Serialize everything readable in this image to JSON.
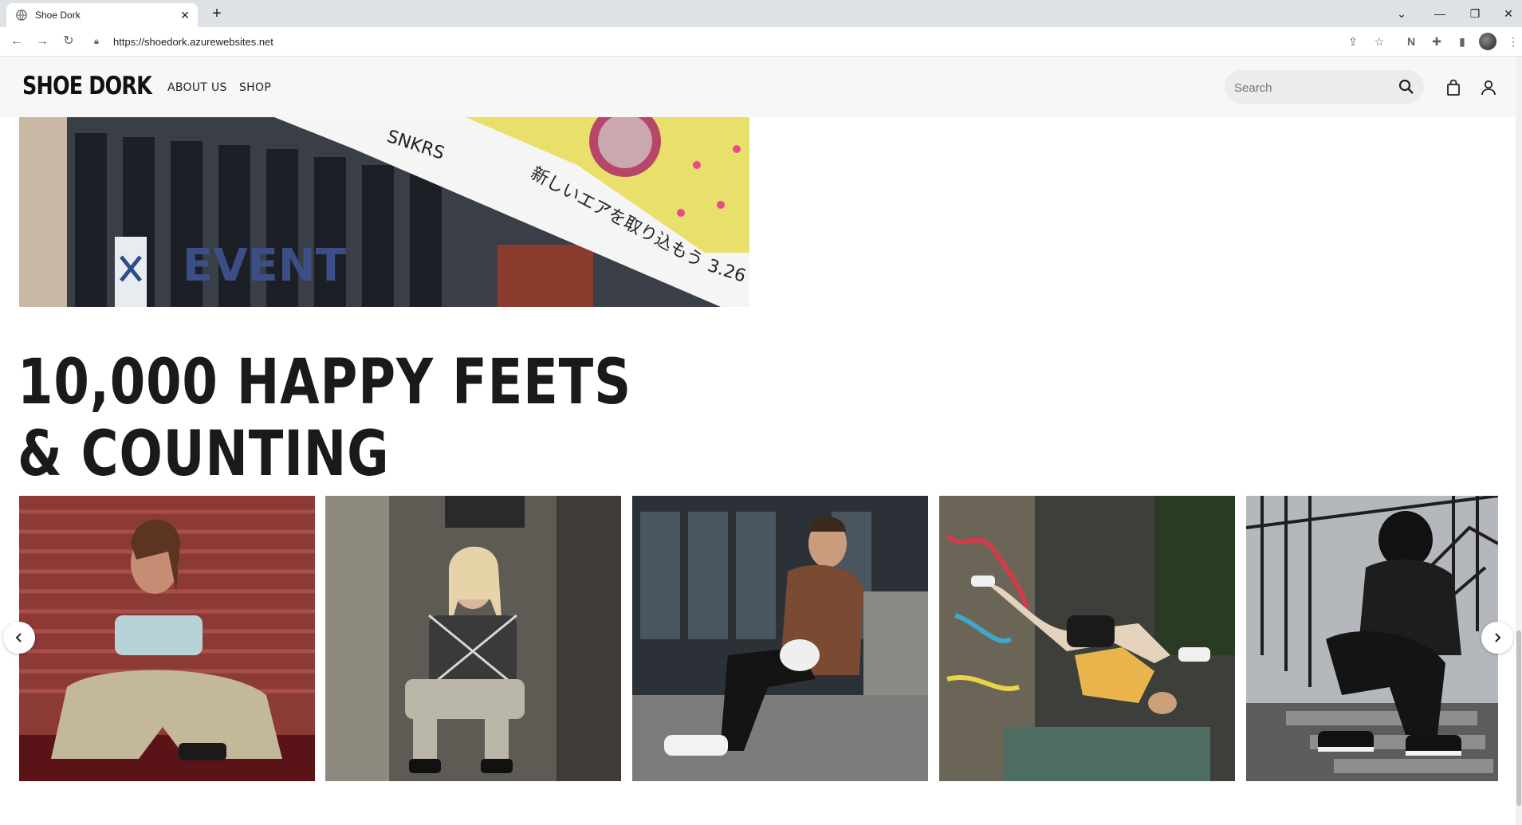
{
  "browser": {
    "tab_title": "Shoe Dork",
    "url": "https://shoedork.azurewebsites.net",
    "new_tab_label": "+"
  },
  "site": {
    "logo": "SHOE DORK",
    "nav": [
      {
        "label": "ABOUT US"
      },
      {
        "label": "SHOP"
      }
    ],
    "search_placeholder": "Search"
  },
  "hero": {
    "sign_text": "新しいエアを取り込もう",
    "sign_date": "3.26",
    "sign_tag": "SNKRS",
    "building_text": "EVENT"
  },
  "heading": {
    "line1": "10,000 HAPPY FEETS",
    "line2": "& COUNTING"
  },
  "carousel": {
    "slides": [
      {
        "name": "photo-woman-red-wall"
      },
      {
        "name": "photo-woman-plaid-jacket"
      },
      {
        "name": "photo-man-brown-jacket"
      },
      {
        "name": "photo-girl-graffiti-wall"
      },
      {
        "name": "photo-hooded-figure-stairs"
      }
    ]
  },
  "colors": {
    "header_bg": "#f7f7f7",
    "text_dark": "#1a1a1a",
    "search_bg": "#ececec"
  }
}
